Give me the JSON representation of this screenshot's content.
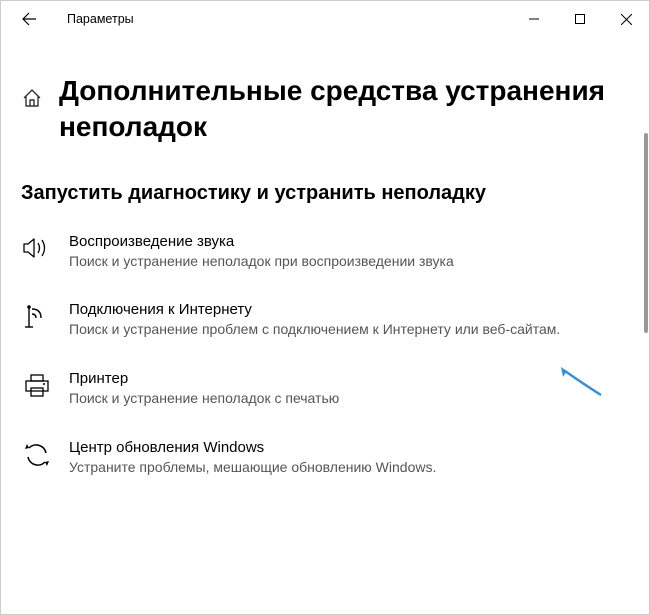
{
  "window": {
    "title": "Параметры"
  },
  "page": {
    "title": "Дополнительные средства устранения неполадок"
  },
  "section": {
    "heading": "Запустить диагностику и устранить неполадку"
  },
  "troubleshooters": {
    "items": [
      {
        "title": "Воспроизведение звука",
        "desc": "Поиск и устранение неполадок при воспроизведении звука"
      },
      {
        "title": "Подключения к Интернету",
        "desc": "Поиск и устранение проблем с подключением к Интернету или веб-сайтам."
      },
      {
        "title": "Принтер",
        "desc": "Поиск и устранение неполадок с печатью"
      },
      {
        "title": "Центр обновления Windows",
        "desc": "Устраните проблемы, мешающие обновлению Windows."
      }
    ]
  }
}
